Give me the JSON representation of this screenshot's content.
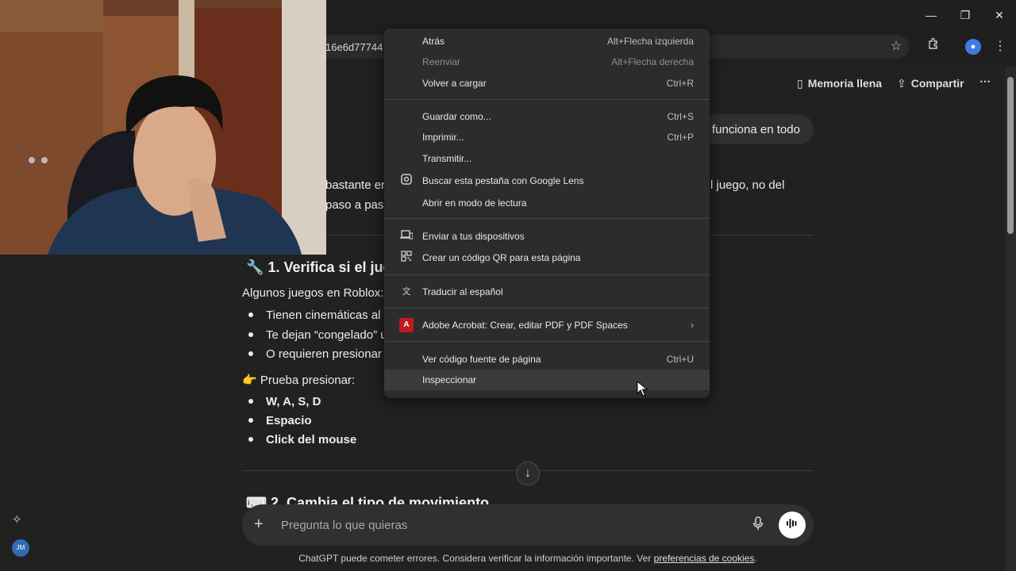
{
  "browser": {
    "url_fragment": "16e6d77744",
    "window": {
      "minimize": "—",
      "restore": "❐",
      "close": "✕"
    },
    "profile_initial": "●"
  },
  "header": {
    "memory_label": "Memoria llena",
    "share_label": "Compartir",
    "more_label": "⋯"
  },
  "chat": {
    "user_bubble_text": "funciona en todo",
    "para_left_1": "bastante er",
    "para_right_1": "l juego, no del",
    "para_left_2": "paso a paso",
    "section1_title": "1. Verifica si el jue",
    "intro_text": "Algunos juegos en Roblox:",
    "list1": [
      "Tienen cinemáticas al i",
      "Te dejan “congelado” u",
      "O requieren presionar"
    ],
    "try_text": "Prueba presionar:",
    "list2": [
      "W, A, S, D",
      "Espacio",
      "Click del mouse"
    ],
    "section2_title": "2. Cambia el tipo de movimiento"
  },
  "composer": {
    "placeholder": "Pregunta lo que quieras",
    "plus": "+"
  },
  "footer": {
    "text": "ChatGPT puede cometer errores. Considera verificar la información importante. Ver",
    "link": "preferencias de cookies",
    "end": "."
  },
  "sidebar": {
    "avatar_initials": "JM"
  },
  "context_menu": {
    "items": [
      {
        "label": "Atrás",
        "shortcut": "Alt+Flecha izquierda"
      },
      {
        "label": "Reenviar",
        "shortcut": "Alt+Flecha derecha"
      },
      {
        "label": "Volver a cargar",
        "shortcut": "Ctrl+R"
      },
      {
        "label": "Guardar como...",
        "shortcut": "Ctrl+S"
      },
      {
        "label": "Imprimir...",
        "shortcut": "Ctrl+P"
      },
      {
        "label": "Transmitir...",
        "shortcut": ""
      },
      {
        "label": "Buscar esta pestaña con Google Lens",
        "shortcut": ""
      },
      {
        "label": "Abrir en modo de lectura",
        "shortcut": ""
      },
      {
        "label": "Enviar a tus dispositivos",
        "shortcut": ""
      },
      {
        "label": "Crear un código QR para esta página",
        "shortcut": ""
      },
      {
        "label": "Traducir al español",
        "shortcut": ""
      },
      {
        "label": "Adobe Acrobat: Crear, editar PDF y PDF Spaces",
        "shortcut": "›"
      },
      {
        "label": "Ver código fuente de página",
        "shortcut": "Ctrl+U"
      },
      {
        "label": "Inspeccionar",
        "shortcut": ""
      }
    ]
  },
  "colors": {
    "background": "#212121",
    "menu": "#2c2c2c",
    "accent": "#3d7ce6"
  },
  "icons": [
    "star-icon",
    "extensions-icon",
    "kebab-icon",
    "lens-icon",
    "devices-icon",
    "qr-icon",
    "translate-icon",
    "pdf-icon",
    "wrench-icon",
    "pointing-hand-icon",
    "mic-icon",
    "voice-icon",
    "sparkle-icon"
  ]
}
